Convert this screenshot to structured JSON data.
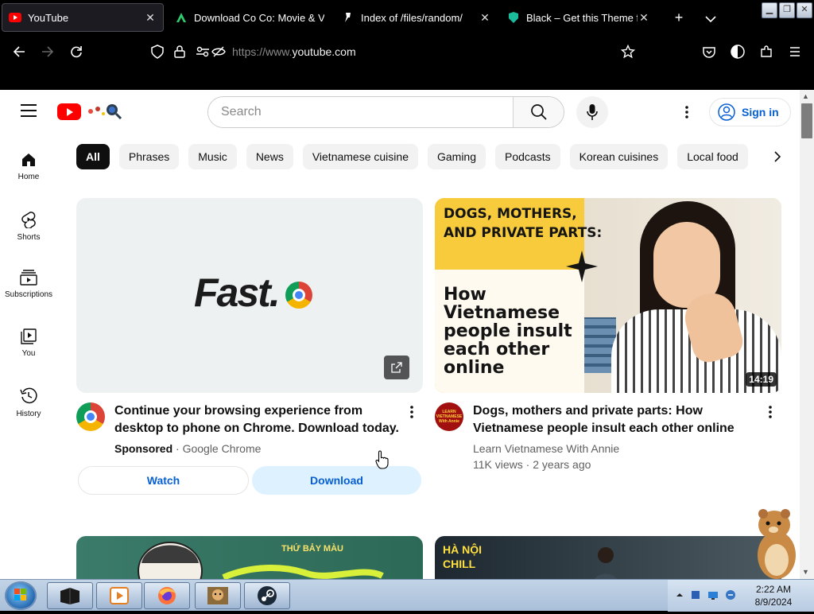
{
  "browser": {
    "tabs": [
      {
        "title": "YouTube",
        "active": true
      },
      {
        "title": "Download Co Co: Movie & V"
      },
      {
        "title": "Index of /files/random/"
      },
      {
        "title": "Black – Get this Theme for"
      }
    ],
    "new_tab_icon": "plus-icon",
    "tab_list_icon": "chevron-down-icon",
    "url_prefix": "https://www.",
    "url_domain": "youtube.com"
  },
  "youtube": {
    "search_placeholder": "Search",
    "sign_in_label": "Sign in",
    "sidebar": [
      {
        "label": "Home",
        "icon": "home-icon"
      },
      {
        "label": "Shorts",
        "icon": "shorts-icon"
      },
      {
        "label": "Subscriptions",
        "icon": "subscriptions-icon"
      },
      {
        "label": "You",
        "icon": "you-icon"
      },
      {
        "label": "History",
        "icon": "history-icon"
      }
    ],
    "chips": [
      "All",
      "Phrases",
      "Music",
      "News",
      "Vietnamese cuisine",
      "Gaming",
      "Podcasts",
      "Korean cuisines",
      "Local food"
    ],
    "ad_card": {
      "thumb_text": "Fast.",
      "title": "Continue your browsing experience from desktop to phone on Chrome. Download today.",
      "sponsored": "Sponsored",
      "advertiser": "Google Chrome",
      "watch_label": "Watch",
      "download_label": "Download"
    },
    "video_card": {
      "thumb_heading": "DOGS, MOTHERS, AND PRIVATE PARTS:",
      "thumb_subheading": "How Vietnamese people insult each other online",
      "duration": "14:19",
      "title": "Dogs, mothers and private parts: How Vietnamese people insult each other online",
      "channel": "Learn Vietnamese With Annie",
      "avatar_text": "LEARN VIETNAMESE With Annie",
      "views": "11K views",
      "age": "2 years ago"
    },
    "row2": {
      "left_text": "THỨ BẢY MÀU",
      "right_text": "HÀ NỘI CHILL"
    }
  },
  "taskbar": {
    "time": "2:22 AM",
    "date": "8/9/2024"
  },
  "colors": {
    "youtube_red": "#ff0000",
    "link_blue": "#065fd4",
    "chip_active": "#0f0f0f"
  }
}
